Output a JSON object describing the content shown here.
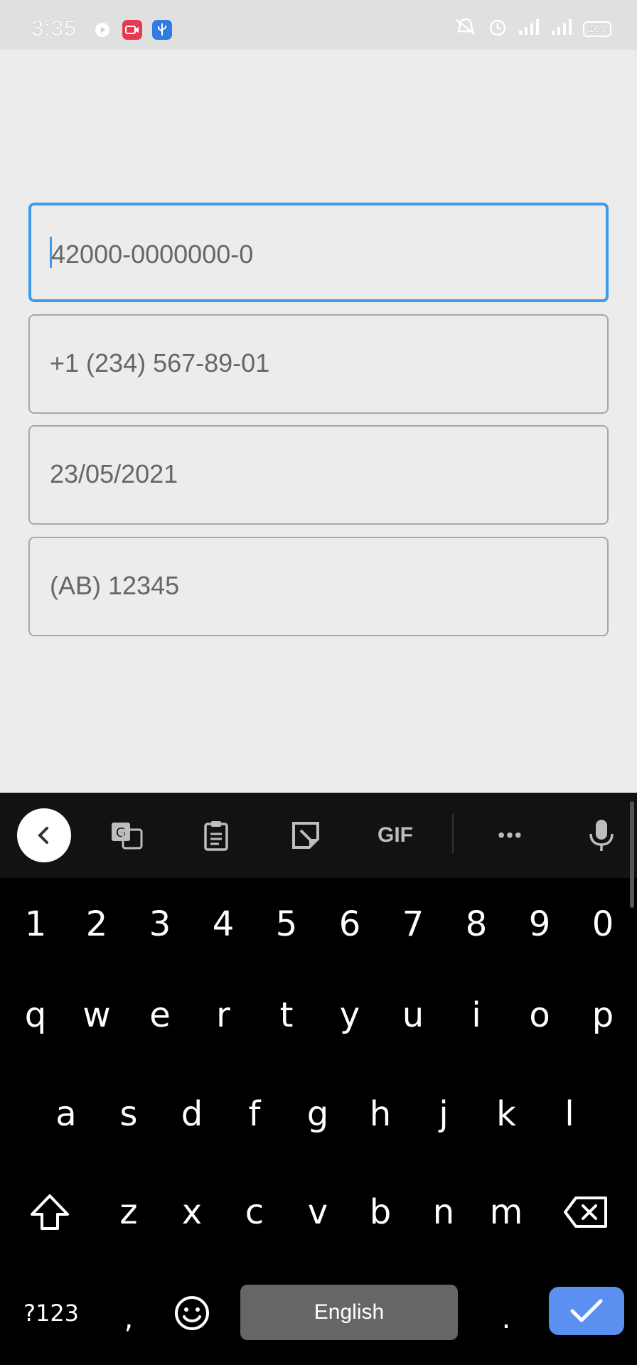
{
  "status_bar": {
    "time": "3:35",
    "battery": "100",
    "icons": [
      "media-icon",
      "screen-record-icon",
      "usb-icon",
      "silent-icon",
      "alarm-icon",
      "signal-icon",
      "signal-icon"
    ]
  },
  "fields": [
    {
      "value": "42000-0000000-0",
      "focused": true
    },
    {
      "value": "+1 (234) 567-89-01",
      "focused": false
    },
    {
      "value": "23/05/2021",
      "focused": false
    },
    {
      "value": "(AB) 12345",
      "focused": false
    }
  ],
  "keyboard": {
    "toolbar": [
      "back-icon",
      "translate-icon",
      "clipboard-icon",
      "sticker-icon",
      "GIF",
      "more-icon",
      "mic-icon"
    ],
    "gif_label": "GIF",
    "more_label": "•••",
    "row_numbers": [
      "1",
      "2",
      "3",
      "4",
      "5",
      "6",
      "7",
      "8",
      "9",
      "0"
    ],
    "row1": [
      "q",
      "w",
      "e",
      "r",
      "t",
      "y",
      "u",
      "i",
      "o",
      "p"
    ],
    "row2": [
      "a",
      "s",
      "d",
      "f",
      "g",
      "h",
      "j",
      "k",
      "l"
    ],
    "row3": [
      "z",
      "x",
      "c",
      "v",
      "b",
      "n",
      "m"
    ],
    "symbols_label": "?123",
    "comma": ",",
    "space_label": "English",
    "period": ".",
    "accent_color": "#3d9be9",
    "enter_color": "#5b8ff0"
  }
}
